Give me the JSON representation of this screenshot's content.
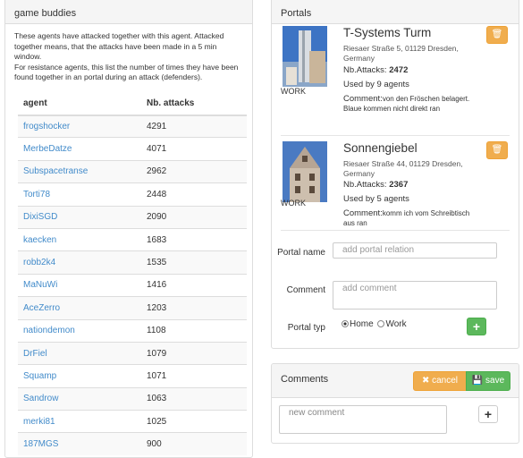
{
  "buddies": {
    "title": "game buddies",
    "intro": [
      "These agents have attacked together with this agent. Attacked together means, that the attacks have been made in a 5 min window.",
      "For resistance agents, this list the number of times they have been found together in an portal during an attack (defenders)."
    ],
    "col_agent": "agent",
    "col_attacks": "Nb. attacks",
    "rows": [
      {
        "agent": "frogshocker",
        "attacks": "4291"
      },
      {
        "agent": "MerbeDatze",
        "attacks": "4071"
      },
      {
        "agent": "Subspacetranse",
        "attacks": "2962"
      },
      {
        "agent": "Torti78",
        "attacks": "2448"
      },
      {
        "agent": "DixiSGD",
        "attacks": "2090"
      },
      {
        "agent": "kaecken",
        "attacks": "1683"
      },
      {
        "agent": "robb2k4",
        "attacks": "1535"
      },
      {
        "agent": "MaNuWi",
        "attacks": "1416"
      },
      {
        "agent": "AceZerro",
        "attacks": "1203"
      },
      {
        "agent": "nationdemon",
        "attacks": "1108"
      },
      {
        "agent": "DrFiel",
        "attacks": "1079"
      },
      {
        "agent": "Squamp",
        "attacks": "1071"
      },
      {
        "agent": "Sandrow",
        "attacks": "1063"
      },
      {
        "agent": "merki81",
        "attacks": "1025"
      },
      {
        "agent": "187MGS",
        "attacks": "900"
      }
    ]
  },
  "portals": {
    "title": "Portals",
    "items": [
      {
        "type": "WORK",
        "name": "T-Systems Turm",
        "address": "Riesaer Straße 5, 01129 Dresden, Germany",
        "attacks_label": "Nb.Attacks:",
        "attacks": "2472",
        "used": "Used by 9 agents",
        "comment_label": "Comment:",
        "comment": "von den Fröschen belagert. Blaue kommen nicht direkt ran",
        "delete_icon": "trash-icon"
      },
      {
        "type": "WORK",
        "name": "Sonnengiebel",
        "address": "Riesaer Straße 44, 01129 Dresden, Germany",
        "attacks_label": "Nb.Attacks:",
        "attacks": "2367",
        "used": "Used by 5 agents",
        "comment_label": "Comment:",
        "comment": "komm ich vom Schreibtisch aus ran",
        "delete_icon": "trash-icon"
      }
    ],
    "form": {
      "name_label": "Portal name",
      "name_placeholder": "add portal relation",
      "comment_label": "Comment",
      "comment_placeholder": "add comment",
      "type_label": "Portal typ",
      "opt_home": "Home",
      "opt_work": "Work",
      "selected": "Home",
      "add_label": "+"
    }
  },
  "comments": {
    "title": "Comments",
    "cancel_label": "cancel",
    "save_label": "save",
    "new_placeholder": "new comment",
    "add_label": "+"
  },
  "colors": {
    "warning": "#f0ad4e",
    "success": "#5cb85c",
    "link": "#428bca"
  }
}
